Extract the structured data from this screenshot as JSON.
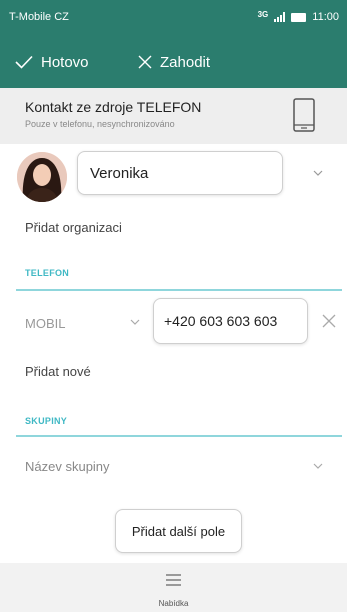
{
  "status_bar": {
    "carrier": "T-Mobile CZ",
    "network": "3G",
    "time": "11:00"
  },
  "toolbar": {
    "done_label": "Hotovo",
    "discard_label": "Zahodit"
  },
  "account": {
    "title": "Kontakt ze zdroje TELEFON",
    "subtitle": "Pouze v telefonu, nesynchronizováno",
    "icon": "phone-icon"
  },
  "contact": {
    "name": "Veronika"
  },
  "organization": {
    "add_label": "Přidat organizaci"
  },
  "phone_section": {
    "header": "TELEFON",
    "type": "MOBIL",
    "number": "+420 603 603 603",
    "add_new": "Přidat nové"
  },
  "groups_section": {
    "header": "SKUPINY",
    "placeholder": "Název skupiny"
  },
  "add_field_button": "Přidat další pole",
  "bottom_menu": {
    "label": "Nabídka"
  },
  "colors": {
    "accent": "#2b7d6e",
    "section_header": "#3fb8c4",
    "divider": "#8fd6dc"
  }
}
